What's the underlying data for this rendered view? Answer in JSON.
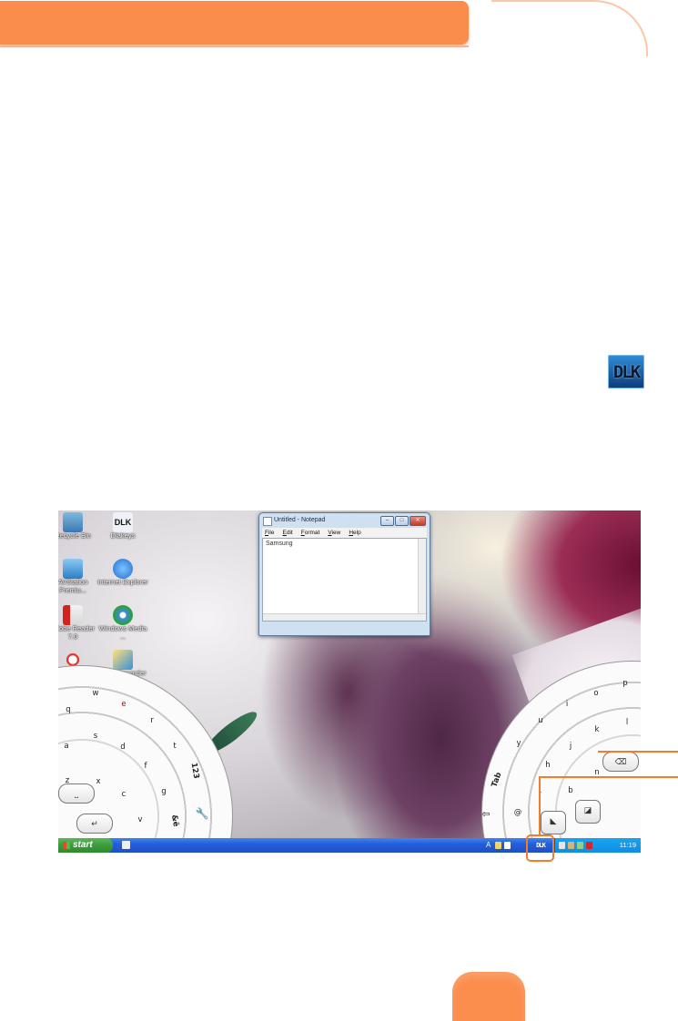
{
  "icon_sample": {
    "text": "DLK"
  },
  "screenshot": {
    "desktop_icons": [
      {
        "label": "Recycle Bin",
        "name": "recycle-bin"
      },
      {
        "label": "Dlakeys",
        "name": "dlakeys"
      },
      {
        "label": "AVStation Premiu...",
        "name": "avstation"
      },
      {
        "label": "Internet Explorer",
        "name": "internet-explorer"
      },
      {
        "label": "Adobe Reader 7.0",
        "name": "adobe-reader"
      },
      {
        "label": "Windows Media ...",
        "name": "windows-media"
      },
      {
        "label": "",
        "name": "unknown-icon"
      },
      {
        "label": "Voice Recorder",
        "name": "voice-recorder"
      }
    ],
    "notepad": {
      "title": "Untitled - Notepad",
      "menu": [
        "File",
        "Edit",
        "Format",
        "View",
        "Help"
      ],
      "text": "Samsung",
      "buttons": {
        "min": "–",
        "max": "□",
        "close": "✕"
      }
    },
    "keyboard_left": {
      "keys": [
        "q",
        "w",
        "e",
        "r",
        "t",
        "a",
        "s",
        "d",
        "f",
        "g",
        "z",
        "x",
        "c",
        "v",
        "123",
        "&ë"
      ],
      "pills": [
        "⎵",
        "↵"
      ]
    },
    "keyboard_right": {
      "keys": [
        "p",
        "o",
        "i",
        "u",
        "y",
        "l",
        "k",
        "j",
        "h",
        "n",
        "b",
        "Tab",
        "@",
        "."
      ],
      "pills": [
        "⌫",
        "⇦"
      ]
    },
    "taskbar": {
      "start": "start",
      "tray_letter": "A",
      "dlk": "DLK",
      "clock": "11:19"
    }
  },
  "colors": {
    "accent": "#f47b2a",
    "header": "#fa8c4c",
    "taskbar": "#245edb"
  }
}
